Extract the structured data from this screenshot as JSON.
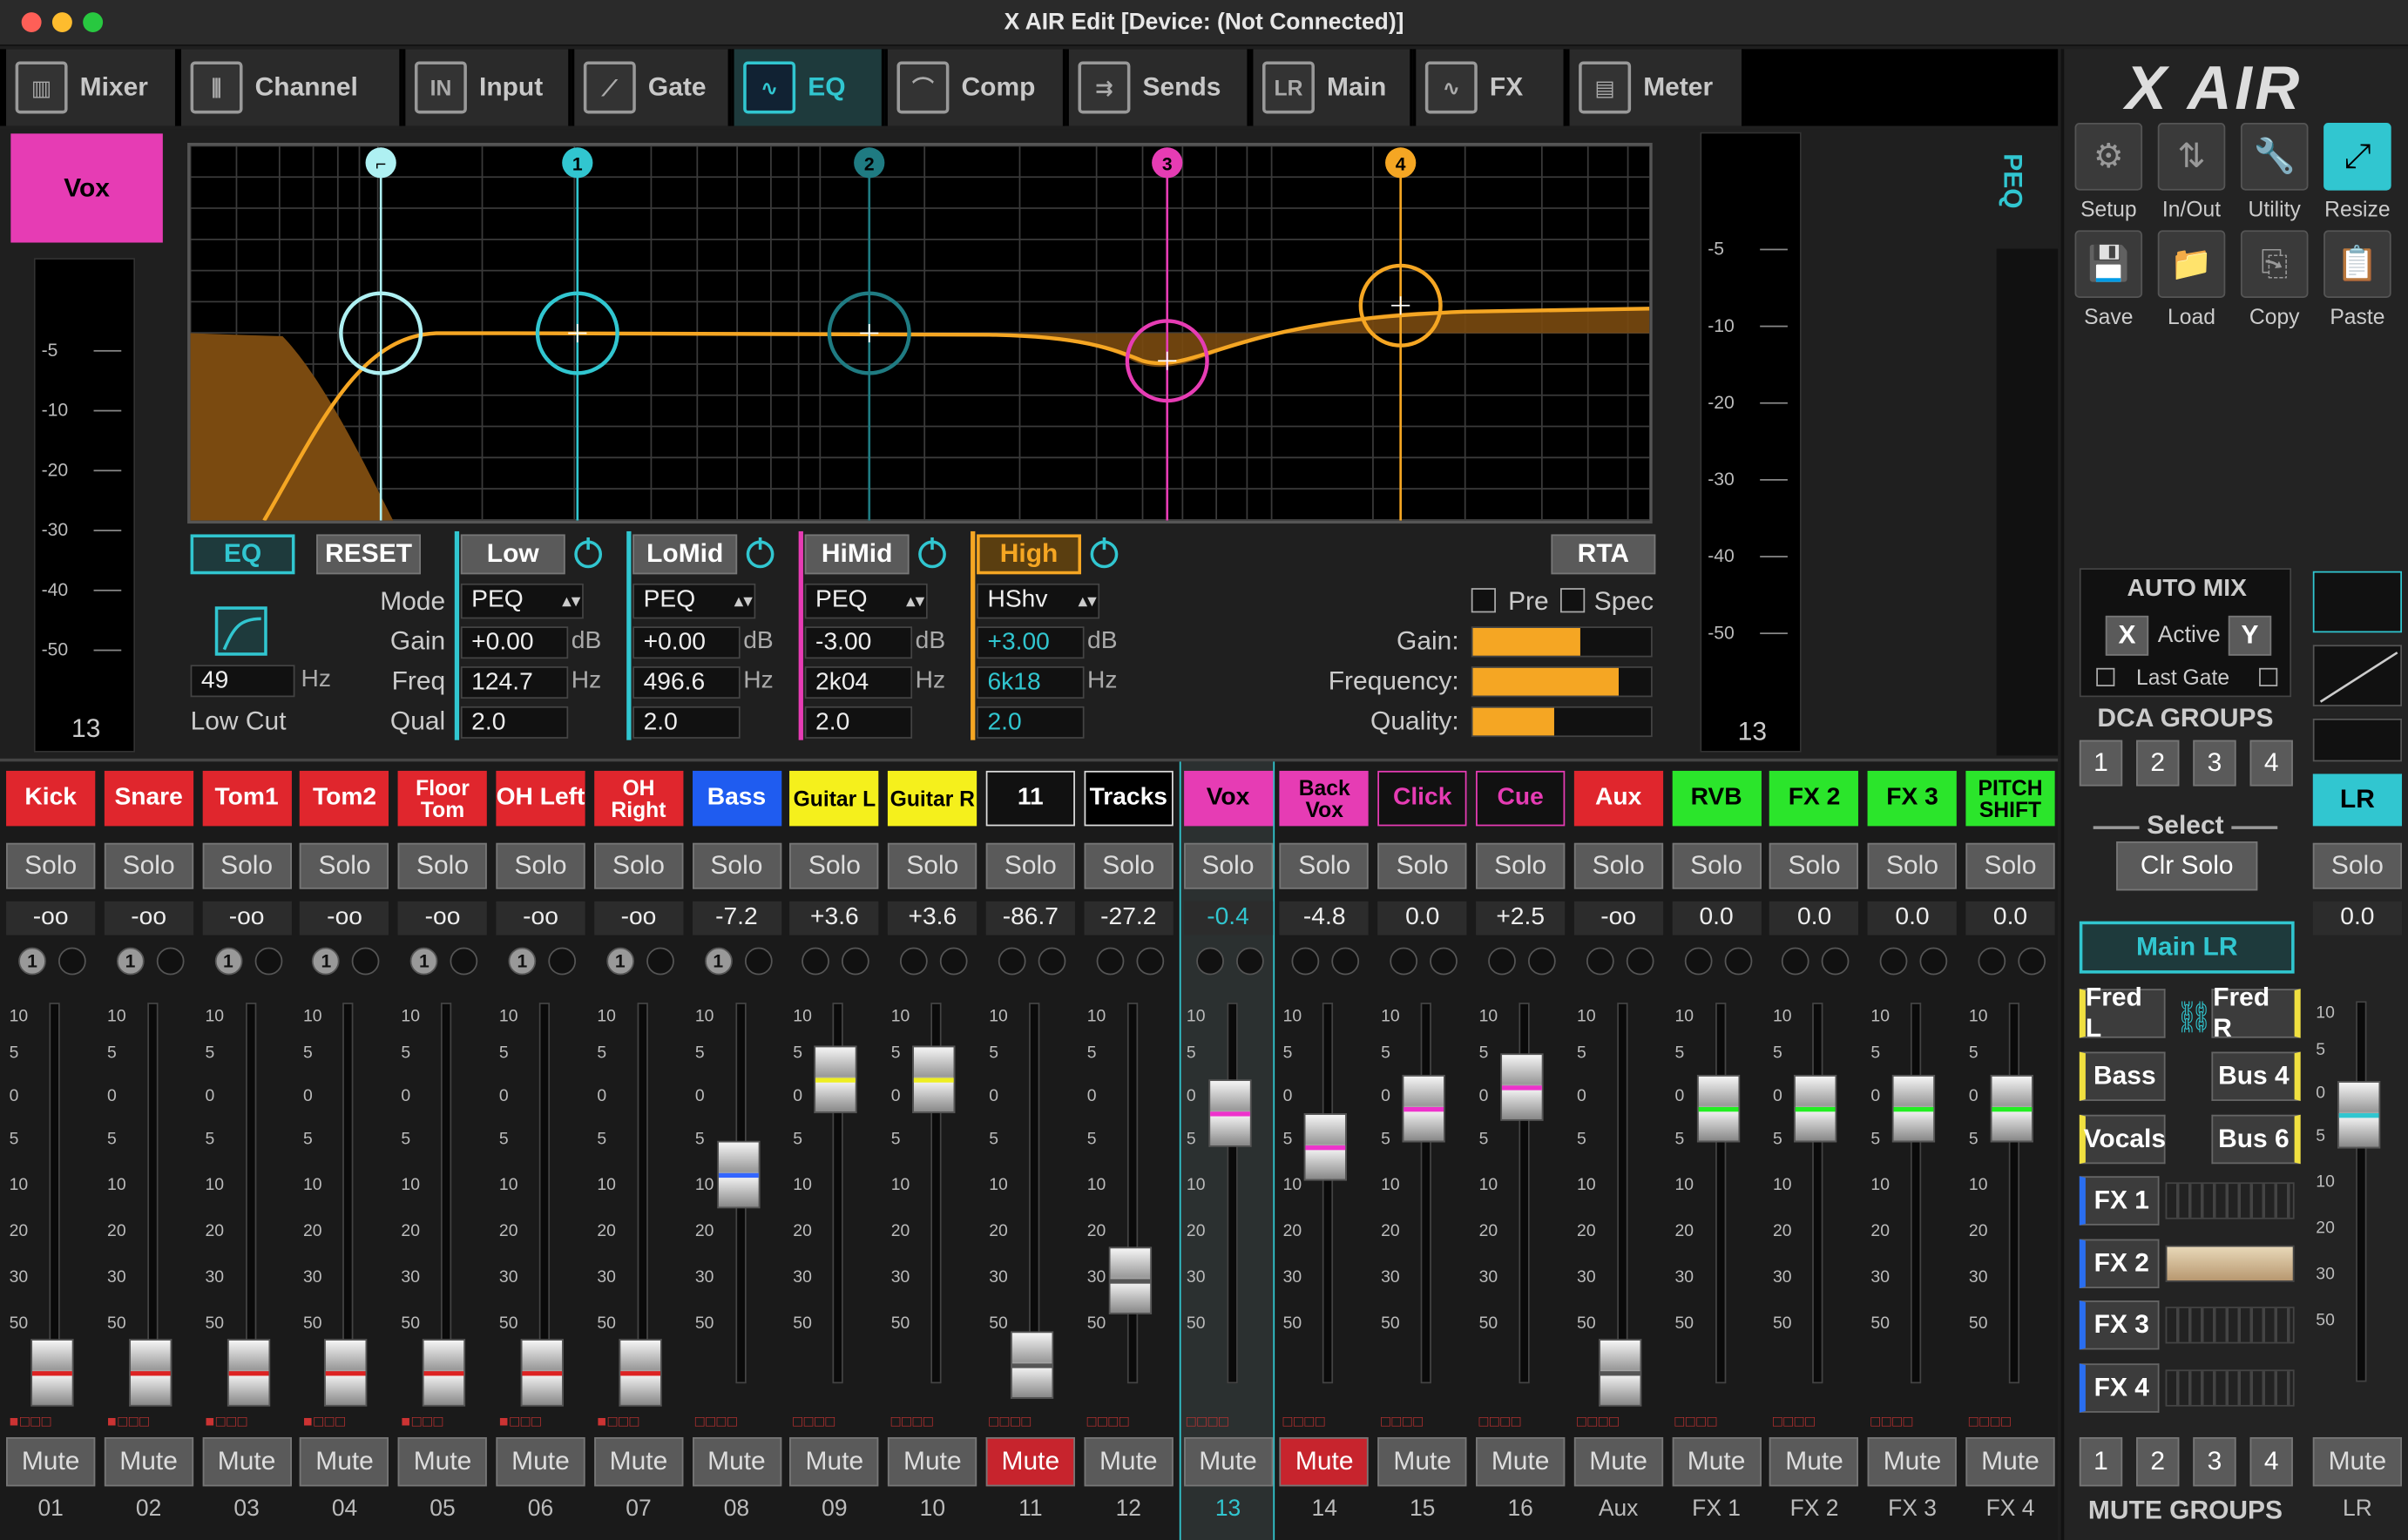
{
  "window": {
    "title": "X AIR Edit [Device: (Not Connected)]"
  },
  "tabs": [
    {
      "label": "Mixer",
      "icon": "mixer-icon"
    },
    {
      "label": "Channel",
      "icon": "channel-icon"
    },
    {
      "label": "Input",
      "icon": "input-icon"
    },
    {
      "label": "Gate",
      "icon": "gate-icon"
    },
    {
      "label": "EQ",
      "icon": "eq-icon",
      "active": true
    },
    {
      "label": "Comp",
      "icon": "comp-icon"
    },
    {
      "label": "Sends",
      "icon": "sends-icon"
    },
    {
      "label": "Main",
      "icon": "main-icon"
    },
    {
      "label": "FX",
      "icon": "fx-icon"
    },
    {
      "label": "Meter",
      "icon": "meter-icon"
    }
  ],
  "brand": {
    "logo_text": "X AIR"
  },
  "tools": [
    {
      "label": "Setup"
    },
    {
      "label": "In/Out"
    },
    {
      "label": "Utility"
    },
    {
      "label": "Resize",
      "active": true
    },
    {
      "label": "Save"
    },
    {
      "label": "Load"
    },
    {
      "label": "Copy"
    },
    {
      "label": "Paste"
    }
  ],
  "channel": {
    "name": "Vox",
    "color": "#e63cb4",
    "meter_value": "13",
    "peq_label": "PEQ",
    "out_meter_value": "13"
  },
  "left_meter_scale": [
    "-5",
    "-10",
    "-20",
    "-30",
    "-40",
    "-50"
  ],
  "right_meter_scale": [
    "-5",
    "-10",
    "-20",
    "-30",
    "-40",
    "-50"
  ],
  "eq": {
    "eq_button": "EQ",
    "reset_button": "RESET",
    "rta_button": "RTA",
    "labels": {
      "mode": "Mode",
      "gain": "Gain",
      "freq": "Freq",
      "qual": "Qual",
      "low_cut": "Low Cut",
      "pre": "Pre",
      "spec": "Spec"
    },
    "low_cut_value": "49",
    "hz": "Hz",
    "db": "dB",
    "bands": [
      {
        "name": "Low",
        "mode": "PEQ",
        "gain": "+0.00",
        "freq": "124.7",
        "q": "2.0",
        "color": "#31c6d0",
        "handle": "1"
      },
      {
        "name": "LoMid",
        "mode": "PEQ",
        "gain": "+0.00",
        "freq": "496.6",
        "q": "2.0",
        "color": "#31c6d0",
        "handle": "2"
      },
      {
        "name": "HiMid",
        "mode": "PEQ",
        "gain": "-3.00",
        "freq": "2k04",
        "q": "2.0",
        "color": "#e63cb4",
        "handle": "3"
      },
      {
        "name": "High",
        "mode": "HShv",
        "gain": "+3.00",
        "freq": "6k18",
        "q": "2.0",
        "color": "#f5a623",
        "handle": "4"
      }
    ],
    "rta": {
      "gain_label": "Gain:",
      "freq_label": "Frequency:",
      "quality_label": "Quality:",
      "gain": 0.6,
      "frequency": 0.82,
      "quality": 0.46
    }
  },
  "strips": [
    {
      "name": "Kick",
      "color": "#e0262d",
      "text": "#fff",
      "level": "-oo",
      "fader": 0.03,
      "capline": "#d22",
      "mute": false,
      "num": "01",
      "k1": "1"
    },
    {
      "name": "Snare",
      "color": "#e0262d",
      "text": "#fff",
      "level": "-oo",
      "fader": 0.03,
      "capline": "#d22",
      "mute": false,
      "num": "02",
      "k1": "1"
    },
    {
      "name": "Tom1",
      "color": "#e0262d",
      "text": "#fff",
      "level": "-oo",
      "fader": 0.03,
      "capline": "#d22",
      "mute": false,
      "num": "03",
      "k1": "1"
    },
    {
      "name": "Tom2",
      "color": "#e0262d",
      "text": "#fff",
      "level": "-oo",
      "fader": 0.03,
      "capline": "#d22",
      "mute": false,
      "num": "04",
      "k1": "1"
    },
    {
      "name": "Floor Tom",
      "color": "#e0262d",
      "text": "#fff",
      "level": "-oo",
      "fader": 0.03,
      "capline": "#d22",
      "mute": false,
      "num": "05",
      "k1": "1"
    },
    {
      "name": "OH Left",
      "color": "#e0262d",
      "text": "#fff",
      "level": "-oo",
      "fader": 0.03,
      "capline": "#d22",
      "mute": false,
      "num": "06",
      "k1": "1"
    },
    {
      "name": "OH Right",
      "color": "#e0262d",
      "text": "#fff",
      "level": "-oo",
      "fader": 0.03,
      "capline": "#d22",
      "mute": false,
      "num": "07",
      "k1": "1"
    },
    {
      "name": "Bass",
      "color": "#1f5cf0",
      "text": "#fff",
      "level": "-7.2",
      "fader": 0.55,
      "capline": "#36f",
      "mute": false,
      "num": "08",
      "k1": "1"
    },
    {
      "name": "Guitar L",
      "color": "#f5f01c",
      "text": "#000",
      "level": "+3.6",
      "fader": 0.8,
      "capline": "#ee2",
      "mute": false,
      "num": "09",
      "k1": ""
    },
    {
      "name": "Guitar R",
      "color": "#f5f01c",
      "text": "#000",
      "level": "+3.6",
      "fader": 0.8,
      "capline": "#ee2",
      "mute": false,
      "num": "10",
      "k1": ""
    },
    {
      "name": "11",
      "color": "#111",
      "text": "#fff",
      "level": "-86.7",
      "fader": 0.05,
      "capline": "#555",
      "mute": true,
      "num": "11",
      "k1": ""
    },
    {
      "name": "Tracks",
      "color": "#000",
      "text": "#fff",
      "level": "-27.2",
      "fader": 0.27,
      "capline": "#555",
      "mute": false,
      "num": "12",
      "k1": ""
    },
    {
      "name": "Vox",
      "color": "#e63cb4",
      "text": "#000",
      "level": "-0.4",
      "fader": 0.71,
      "capline": "#e3c",
      "mute": false,
      "num": "13",
      "k1": "",
      "selected": true
    },
    {
      "name": "Back Vox",
      "color": "#e63cb4",
      "text": "#000",
      "level": "-4.8",
      "fader": 0.62,
      "capline": "#e3c",
      "mute": true,
      "num": "14",
      "k1": ""
    },
    {
      "name": "Click",
      "color": "#111",
      "text": "#e63cb4",
      "level": "0.0",
      "fader": 0.72,
      "capline": "#e3c",
      "mute": false,
      "num": "15",
      "k1": ""
    },
    {
      "name": "Cue",
      "color": "#111",
      "text": "#e63cb4",
      "level": "+2.5",
      "fader": 0.78,
      "capline": "#e3c",
      "mute": false,
      "num": "16",
      "k1": ""
    },
    {
      "name": "Aux",
      "color": "#e0262d",
      "text": "#fff",
      "level": "-oo",
      "fader": 0.03,
      "capline": "#555",
      "mute": false,
      "num": "Aux",
      "k1": ""
    },
    {
      "name": "RVB",
      "color": "#2be52b",
      "text": "#000",
      "level": "0.0",
      "fader": 0.72,
      "capline": "#2e2",
      "mute": false,
      "num": "FX 1",
      "k1": ""
    },
    {
      "name": "FX 2",
      "color": "#2be52b",
      "text": "#000",
      "level": "0.0",
      "fader": 0.72,
      "capline": "#2e2",
      "mute": false,
      "num": "FX 2",
      "k1": ""
    },
    {
      "name": "FX 3",
      "color": "#2be52b",
      "text": "#000",
      "level": "0.0",
      "fader": 0.72,
      "capline": "#2e2",
      "mute": false,
      "num": "FX 3",
      "k1": ""
    },
    {
      "name": "PITCH SHIFT",
      "color": "#2be52b",
      "text": "#000",
      "level": "0.0",
      "fader": 0.72,
      "capline": "#2e2",
      "mute": false,
      "num": "FX 4",
      "k1": ""
    }
  ],
  "fader_scale": [
    "10",
    "5",
    "0",
    "5",
    "10",
    "20",
    "30",
    "50"
  ],
  "solo_label": "Solo",
  "mute_label": "Mute",
  "automix": {
    "title": "AUTO MIX",
    "x": "X",
    "active": "Active",
    "y": "Y",
    "last_gate": "Last Gate"
  },
  "dca": {
    "title": "DCA GROUPS",
    "buttons": [
      "1",
      "2",
      "3",
      "4"
    ],
    "select": "Select",
    "clr_solo": "Clr Solo"
  },
  "main_lr": {
    "label": "Main LR"
  },
  "buses": [
    {
      "label": "Fred L",
      "color": "#f0e040"
    },
    {
      "label": "Fred R",
      "color": "#f0e040"
    },
    {
      "label": "Bass",
      "color": "#f0e040"
    },
    {
      "label": "Bus 4",
      "color": "#f0e040"
    },
    {
      "label": "Vocals",
      "color": "#f0e040"
    },
    {
      "label": "Bus 6",
      "color": "#f0e040"
    }
  ],
  "fx_buttons": [
    "FX 1",
    "FX 2",
    "FX 3",
    "FX 4"
  ],
  "mute_groups": {
    "title": "MUTE GROUPS",
    "buttons": [
      "1",
      "2",
      "3",
      "4"
    ]
  },
  "lr": {
    "name": "LR",
    "level": "0.0",
    "num": "LR",
    "fader": 0.7
  }
}
